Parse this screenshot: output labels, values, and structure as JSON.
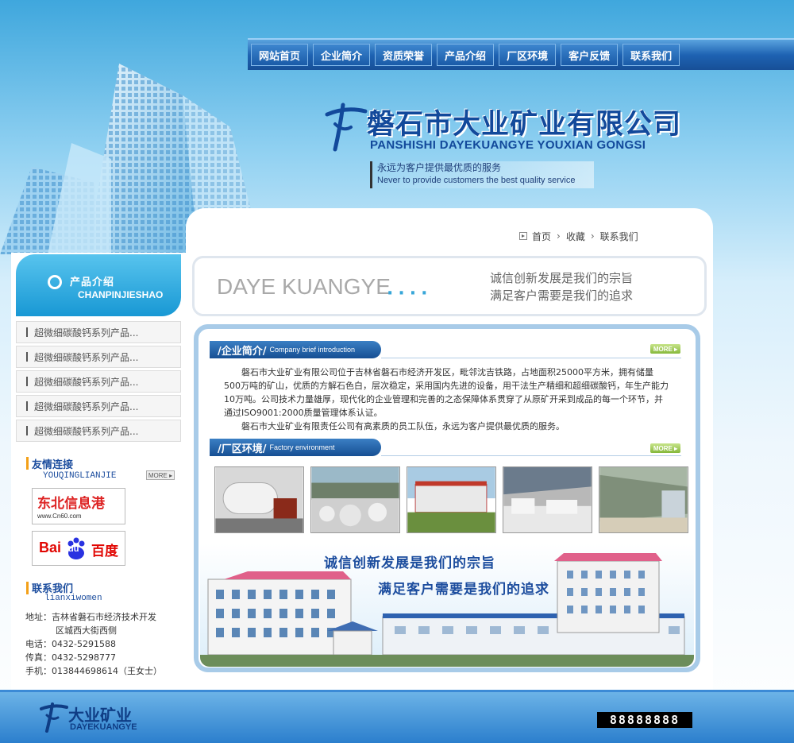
{
  "nav": {
    "items": [
      "网站首页",
      "企业简介",
      "资质荣誉",
      "产品介绍",
      "厂区环境",
      "客户反馈",
      "联系我们"
    ]
  },
  "header": {
    "company_cn": "磐石市大业矿业有限公司",
    "company_en": "PANSHISHI DAYEKUANGYE YOUXIAN GONGSI",
    "slogan_cn": "永远为客户提供最优质的服务",
    "slogan_en": "Never to provide customers the best quality service"
  },
  "breadcrumb": {
    "home": "首页",
    "favorite": "收藏",
    "contact": "联系我们"
  },
  "banner": {
    "title": "DAYE KUANGYE",
    "dots": "····",
    "motto_1": "诚信创新发展是我们的宗旨",
    "motto_2": "满足客户需要是我们的追求"
  },
  "sections": {
    "intro": {
      "cn": "/企业简介/",
      "en": "Company brief introduction",
      "more": "MORE",
      "para_1": "磐石市大业矿业有限公司位于吉林省磐石市经济开发区，毗邻沈吉铁路，占地面积25000平方米，拥有储量500万吨的矿山，优质的方解石色白，层次稳定，采用国内先进的设备，用干法生产精细和超细碳酸钙，年生产能力10万吨。公司技术力量雄厚，现代化的企业管理和完善的之态保障体系贯穿了从原矿开采到成品的每一个环节，并通过ISO9001:2000质量管理体系认证。",
      "para_2": "磐石市大业矿业有限责任公司有高素质的员工队伍，永远为客户提供最优质的服务。"
    },
    "factory": {
      "cn": "/厂区环境/",
      "en": "Factory environment",
      "more": "MORE"
    },
    "factory_banner": {
      "line_1": "诚信创新发展是我们的宗旨",
      "line_2": "满足客户需要是我们的追求"
    }
  },
  "sidebar": {
    "products_cn": "产品介绍",
    "products_en": "CHANPINJIESHAO",
    "products": [
      "超微细碳酸钙系列产品...",
      "超微细碳酸钙系列产品...",
      "超微细碳酸钙系列产品...",
      "超微细碳酸钙系列产品...",
      "超微细碳酸钙系列产品..."
    ],
    "links_cn": "友情连接",
    "links_en": "YOUQINGLIANJIE",
    "links_more": "MORE",
    "link_1_text": "东北信息港",
    "link_1_url": "www.Cn60.com",
    "link_2_text": "百度",
    "link_2_brand": "Bai",
    "link_2_du": "du",
    "contact_cn": "联系我们",
    "contact_en": "lianxiwomen",
    "address_label": "地址：",
    "address_1": "吉林省磐石市经济技术开发",
    "address_2": "区城西大街西侧",
    "phone": "电话：0432-5291588",
    "fax": "传真：0432-5298777",
    "mobile": "手机：013844698614（王女士）"
  },
  "footer": {
    "logo_cn": "大业矿业",
    "logo_en": "DAYEKUANGYE",
    "counter": "88888888"
  },
  "colors": {
    "brand_blue": "#12499b",
    "nav_blue": "#1a5ba8",
    "accent_cyan": "#1898d4",
    "more_green": "#86b83b"
  }
}
